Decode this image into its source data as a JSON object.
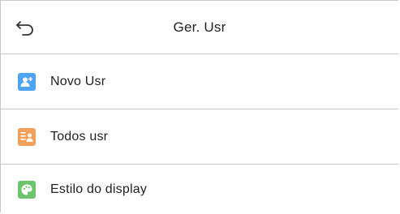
{
  "header": {
    "title": "Ger. Usr"
  },
  "menu": {
    "items": [
      {
        "label": "Novo Usr",
        "icon": "add-user-icon",
        "color": "#4ea3f2"
      },
      {
        "label": "Todos usr",
        "icon": "user-list-icon",
        "color": "#f5a05a"
      },
      {
        "label": "Estilo do display",
        "icon": "palette-icon",
        "color": "#6cc46c"
      }
    ]
  }
}
